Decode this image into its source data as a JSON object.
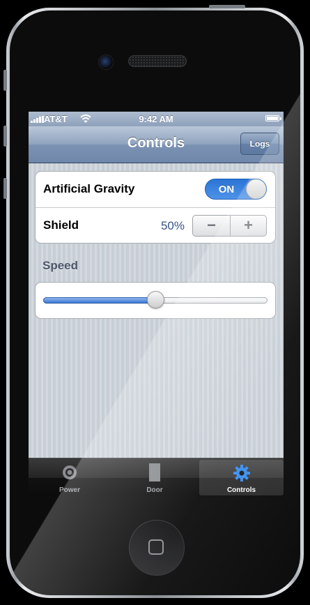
{
  "status_bar": {
    "carrier": "AT&T",
    "time": "9:42 AM"
  },
  "nav": {
    "title": "Controls",
    "logs_button": "Logs"
  },
  "settings": {
    "gravity_label": "Artificial Gravity",
    "gravity_toggle": "ON",
    "shield_label": "Shield",
    "shield_value": "50%",
    "stepper_minus": "−",
    "stepper_plus": "+",
    "speed_header": "Speed",
    "speed_level": 0.5
  },
  "tabs": [
    {
      "label": "Power",
      "icon": "power-icon"
    },
    {
      "label": "Door",
      "icon": "door-icon"
    },
    {
      "label": "Controls",
      "icon": "gear-icon",
      "selected": true
    }
  ],
  "colors": {
    "accent": "#2b74d6",
    "nav_bar": "#7b92b3",
    "shield_value": "#385487"
  }
}
